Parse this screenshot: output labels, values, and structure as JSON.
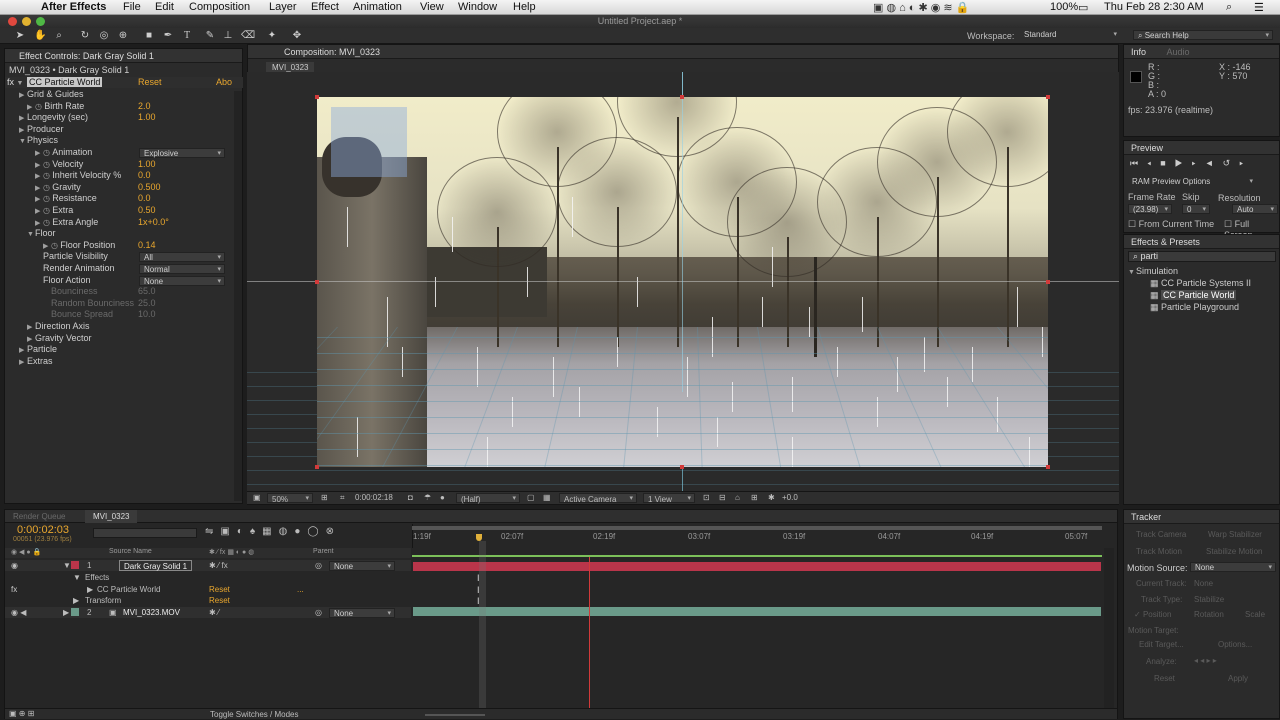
{
  "menubar": {
    "app": "After Effects",
    "items": [
      "File",
      "Edit",
      "Composition",
      "Layer",
      "Effect",
      "Animation",
      "View",
      "Window",
      "Help"
    ],
    "battery": "100%",
    "clock": "Thu Feb 28  2:30 AM"
  },
  "window": {
    "title": "Untitled Project.aep *"
  },
  "workspace": {
    "label": "Workspace:",
    "value": "Standard",
    "search": "Search Help"
  },
  "effect_controls": {
    "tab": "Effect Controls: Dark Gray Solid 1",
    "breadcrumb": "MVI_0323 • Dark Gray Solid 1",
    "effect_name": "CC Particle World",
    "reset": "Reset",
    "about": "Abo",
    "rows": [
      {
        "label": "Grid & Guides",
        "indent": 1,
        "twirl": true,
        "value": ""
      },
      {
        "label": "Birth Rate",
        "indent": 2,
        "stop": true,
        "value": "2.0"
      },
      {
        "label": "Longevity (sec)",
        "indent": 1,
        "twirl": true,
        "value": "1.00"
      },
      {
        "label": "Producer",
        "indent": 1,
        "twirl": true,
        "value": ""
      },
      {
        "label": "Physics",
        "indent": 1,
        "open": true,
        "value": ""
      },
      {
        "label": "Animation",
        "indent": 3,
        "stop": true,
        "select": "Explosive"
      },
      {
        "label": "Velocity",
        "indent": 3,
        "stop": true,
        "value": "1.00"
      },
      {
        "label": "Inherit Velocity %",
        "indent": 3,
        "stop": true,
        "value": "0.0"
      },
      {
        "label": "Gravity",
        "indent": 3,
        "stop": true,
        "value": "0.500"
      },
      {
        "label": "Resistance",
        "indent": 3,
        "stop": true,
        "value": "0.0"
      },
      {
        "label": "Extra",
        "indent": 3,
        "stop": true,
        "value": "0.50"
      },
      {
        "label": "Extra Angle",
        "indent": 3,
        "stop": true,
        "value": "1x+0.0°"
      },
      {
        "label": "Floor",
        "indent": 2,
        "open": true,
        "value": ""
      },
      {
        "label": "Floor Position",
        "indent": 4,
        "stop": true,
        "value": "0.14"
      },
      {
        "label": "Particle Visibility",
        "indent": 4,
        "select": "All"
      },
      {
        "label": "Render Animation",
        "indent": 4,
        "select": "Normal"
      },
      {
        "label": "Floor Action",
        "indent": 4,
        "select": "None"
      },
      {
        "label": "Bounciness",
        "indent": 5,
        "value": "65.0",
        "disabled": true
      },
      {
        "label": "Random Bounciness",
        "indent": 5,
        "value": "25.0",
        "disabled": true
      },
      {
        "label": "Bounce Spread",
        "indent": 5,
        "value": "10.0",
        "disabled": true
      },
      {
        "label": "Direction Axis",
        "indent": 2,
        "twirl": true,
        "value": ""
      },
      {
        "label": "Gravity Vector",
        "indent": 2,
        "twirl": true,
        "value": ""
      },
      {
        "label": "Particle",
        "indent": 1,
        "twirl": true,
        "value": ""
      },
      {
        "label": "Extras",
        "indent": 1,
        "twirl": true,
        "value": ""
      }
    ]
  },
  "composition": {
    "tab": "Composition: MVI_0323",
    "subtab": "MVI_0323",
    "footer": {
      "zoom": "50%",
      "timecode": "0:00:02:18",
      "resolution": "(Half)",
      "camera": "Active Camera",
      "views": "1 View",
      "exposure": "+0.0"
    }
  },
  "info": {
    "tab": "Info",
    "tab2": "Audio",
    "r": "R :",
    "g": "G :",
    "b": "B :",
    "a": "A : 0",
    "x": "X : -146",
    "y": "Y : 570",
    "fps": "fps: 23.976 (realtime)"
  },
  "preview": {
    "tab": "Preview",
    "mode": "RAM Preview Options",
    "frame_rate_label": "Frame Rate",
    "skip_label": "Skip",
    "resolution_label": "Resolution",
    "frame_rate": "(23.98)",
    "skip": "0",
    "resolution": "Auto",
    "from_current": "From Current Time",
    "full_screen": "Full Screen"
  },
  "effects_presets": {
    "tab": "Effects & Presets",
    "search": "parti",
    "category": "Simulation",
    "items": [
      "CC Particle Systems II",
      "CC Particle World",
      "Particle Playground"
    ]
  },
  "tracker": {
    "tab": "Tracker",
    "track_camera": "Track Camera",
    "warp": "Warp Stabilizer",
    "track_motion": "Track Motion",
    "stabilize": "Stabilize Motion",
    "motion_source_label": "Motion Source:",
    "motion_source": "None",
    "current_track": "Current Track:",
    "current_track_value": "None",
    "track_type": "Track Type:",
    "track_type_value": "Stabilize",
    "position": "Position",
    "rotation": "Rotation",
    "scale": "Scale",
    "motion_target": "Motion Target:",
    "edit_target": "Edit Target...",
    "options": "Options...",
    "analyze": "Analyze:",
    "reset": "Reset",
    "apply": "Apply"
  },
  "timeline": {
    "tabs": [
      "Render Queue",
      "MVI_0323"
    ],
    "timecode": "0:00:02:03",
    "fps": "00051 (23.976 fps)",
    "col_source": "Source Name",
    "col_parent": "Parent",
    "layers": [
      {
        "num": "1",
        "name": "Dark Gray Solid 1",
        "parent": "None"
      },
      {
        "num": "2",
        "name": "MVI_0323.MOV",
        "parent": "None"
      }
    ],
    "effects_label": "Effects",
    "effect": "CC Particle World",
    "effect_reset": "Reset",
    "effect_dots": "...",
    "transform": "Transform",
    "transform_reset": "Reset",
    "ruler": [
      "1:19f",
      "02:07f",
      "02:19f",
      "03:07f",
      "03:19f",
      "04:07f",
      "04:19f",
      "05:07f"
    ],
    "toggle": "Toggle Switches / Modes"
  },
  "colors": {
    "accent": "#e9a72e",
    "bg": "#2b2b2b",
    "layer1": "#b9354a",
    "layer2": "#6a9a89",
    "grid": "#5f96af"
  }
}
